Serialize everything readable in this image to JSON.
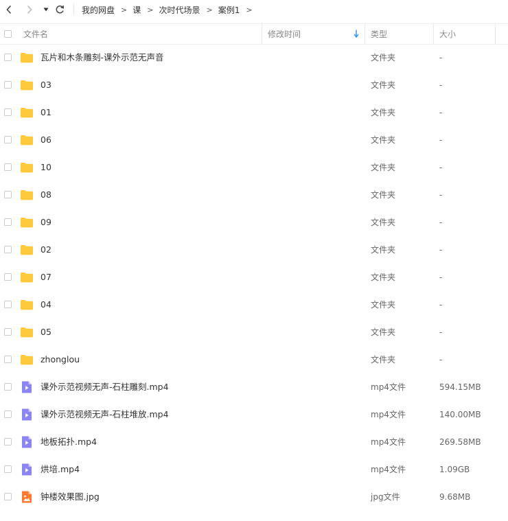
{
  "toolbar": {
    "breadcrumbs": [
      "我的网盘",
      "课",
      "次时代场景",
      "案例1"
    ],
    "crumb_separator": ">"
  },
  "columns": {
    "name": "文件名",
    "modified": "修改时间",
    "type": "类型",
    "size": "大小"
  },
  "colors": {
    "folder": "#FFC93C",
    "video": "#8C86F5",
    "image": "#FF7A2E",
    "sort_arrow": "#2B8CF7"
  },
  "files": [
    {
      "name": "瓦片和木条雕刻-课外示范无声音",
      "type": "文件夹",
      "size": "-",
      "icon": "folder-icon"
    },
    {
      "name": "03",
      "type": "文件夹",
      "size": "-",
      "icon": "folder-icon"
    },
    {
      "name": "01",
      "type": "文件夹",
      "size": "-",
      "icon": "folder-icon"
    },
    {
      "name": "06",
      "type": "文件夹",
      "size": "-",
      "icon": "folder-icon"
    },
    {
      "name": "10",
      "type": "文件夹",
      "size": "-",
      "icon": "folder-icon"
    },
    {
      "name": "08",
      "type": "文件夹",
      "size": "-",
      "icon": "folder-icon"
    },
    {
      "name": "09",
      "type": "文件夹",
      "size": "-",
      "icon": "folder-icon"
    },
    {
      "name": "02",
      "type": "文件夹",
      "size": "-",
      "icon": "folder-icon"
    },
    {
      "name": "07",
      "type": "文件夹",
      "size": "-",
      "icon": "folder-icon"
    },
    {
      "name": "04",
      "type": "文件夹",
      "size": "-",
      "icon": "folder-icon"
    },
    {
      "name": "05",
      "type": "文件夹",
      "size": "-",
      "icon": "folder-icon"
    },
    {
      "name": "zhonglou",
      "type": "文件夹",
      "size": "-",
      "icon": "folder-icon"
    },
    {
      "name": "课外示范视频无声-石柱雕刻.mp4",
      "type": "mp4文件",
      "size": "594.15MB",
      "icon": "video-file-icon"
    },
    {
      "name": "课外示范视频无声-石柱堆放.mp4",
      "type": "mp4文件",
      "size": "140.00MB",
      "icon": "video-file-icon"
    },
    {
      "name": "地板拓扑.mp4",
      "type": "mp4文件",
      "size": "269.58MB",
      "icon": "video-file-icon"
    },
    {
      "name": "烘培.mp4",
      "type": "mp4文件",
      "size": "1.09GB",
      "icon": "video-file-icon"
    },
    {
      "name": "钟楼效果图.jpg",
      "type": "jpg文件",
      "size": "9.68MB",
      "icon": "image-file-icon"
    }
  ]
}
